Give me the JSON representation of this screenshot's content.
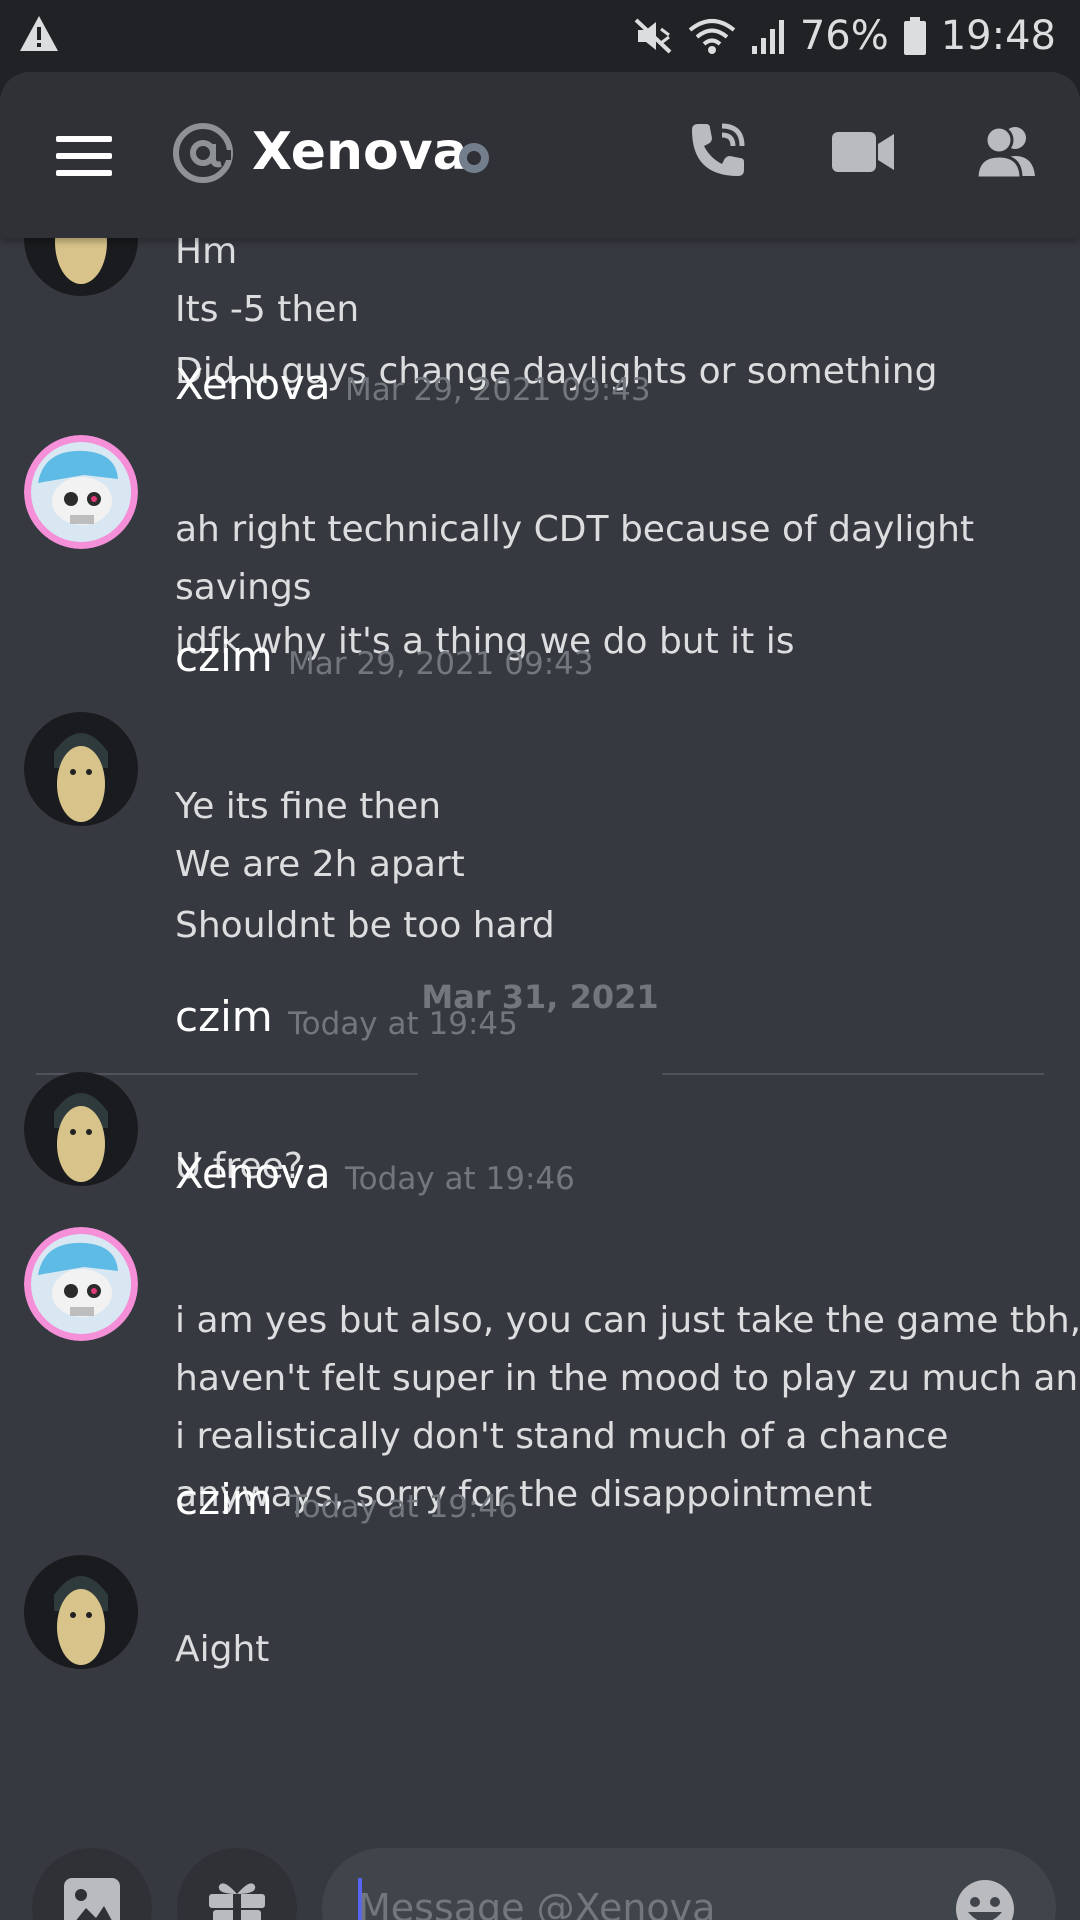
{
  "status_bar": {
    "battery": "76%",
    "time": "19:48"
  },
  "header": {
    "title": "Xenova"
  },
  "messages": {
    "m0_lines": [
      "Hm",
      "Its -5 then",
      "Did u guys change daylights or something"
    ],
    "m1": {
      "author": "Xenova",
      "timestamp": "Mar 29, 2021 09:43",
      "lines": [
        "ah right technically CDT because of daylight",
        "savings",
        "idfk why it's a thing we do but it is"
      ]
    },
    "m2": {
      "author": "czim",
      "timestamp": "Mar 29, 2021 09:43",
      "lines": [
        "Ye its fine then",
        "We are 2h apart",
        "Shouldnt be too hard"
      ]
    },
    "divider": "Mar 31, 2021",
    "m3": {
      "author": "czim",
      "timestamp": "Today at 19:45",
      "lines": [
        "U free?"
      ]
    },
    "m4": {
      "author": "Xenova",
      "timestamp": "Today at 19:46",
      "lines": [
        "i am yes but also, you can just take the game tbh,",
        "haven't felt super in the mood to play zu much and",
        "i realistically don't stand much of a chance",
        "anyways, sorry for the disappointment"
      ]
    },
    "m5": {
      "author": "czim",
      "timestamp": "Today at 19:46",
      "lines": [
        "Aight"
      ]
    }
  },
  "composer": {
    "placeholder": "Message @Xenova"
  },
  "colors": {
    "background": "#36393f",
    "header": "#2f3136",
    "input": "#40444b",
    "accent": "#5865f2",
    "muted": "#72767d"
  }
}
